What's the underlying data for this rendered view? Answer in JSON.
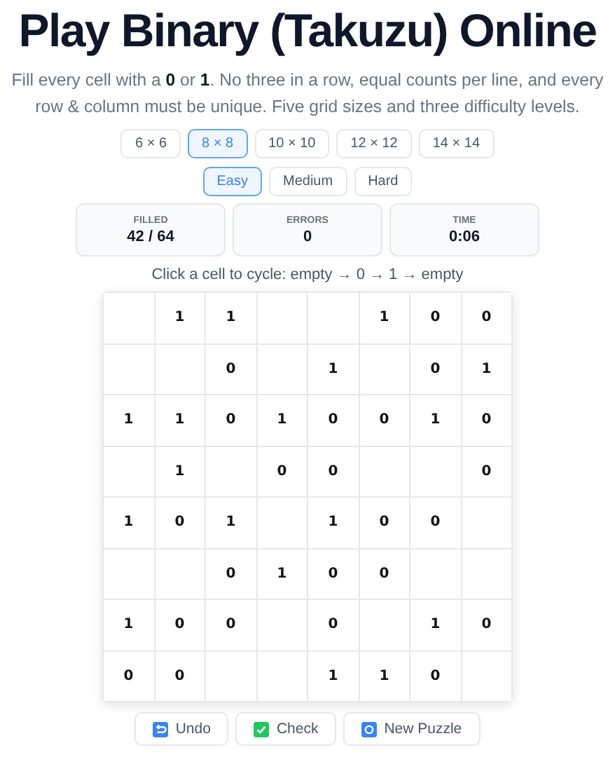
{
  "title": "Play Binary (Takuzu) Online",
  "description": "Fill every cell with a **0** or **1**. No three in a row, equal counts per line, and every row & column must be unique. Five grid sizes and three difficulty levels.",
  "sizes": [
    {
      "label": "6 × 6",
      "selected": false
    },
    {
      "label": "8 × 8",
      "selected": true
    },
    {
      "label": "10 × 10",
      "selected": false
    },
    {
      "label": "12 × 12",
      "selected": false
    },
    {
      "label": "14 × 14",
      "selected": false
    }
  ],
  "difficulties": [
    {
      "label": "Easy",
      "selected": true
    },
    {
      "label": "Medium",
      "selected": false
    },
    {
      "label": "Hard",
      "selected": false
    }
  ],
  "stats": [
    {
      "label": "FILLED",
      "value": "42 / 64"
    },
    {
      "label": "ERRORS",
      "value": "0"
    },
    {
      "label": "TIME",
      "value": "0:06"
    }
  ],
  "hint": "Click a cell to cycle: empty → 0 → 1 → empty",
  "grid": [
    [
      {
        "kind": "empty"
      },
      {
        "kind": "digit",
        "value": "1"
      },
      {
        "kind": "digit",
        "value": "1"
      },
      {
        "kind": "empty"
      },
      {
        "kind": "empty"
      },
      {
        "kind": "digit",
        "value": "1"
      },
      {
        "kind": "digit",
        "value": "0"
      },
      {
        "kind": "digit",
        "value": "0"
      }
    ],
    [
      {
        "kind": "empty"
      },
      {
        "kind": "empty"
      },
      {
        "kind": "digit",
        "value": "0"
      },
      {
        "kind": "empty"
      },
      {
        "kind": "digit",
        "value": "1"
      },
      {
        "kind": "empty"
      },
      {
        "kind": "digit",
        "value": "0"
      },
      {
        "kind": "digit",
        "value": "1"
      }
    ],
    [
      {
        "kind": "digit",
        "value": "1"
      },
      {
        "kind": "digit",
        "value": "1"
      },
      {
        "kind": "digit",
        "value": "0"
      },
      {
        "kind": "digit",
        "value": "1"
      },
      {
        "kind": "digit",
        "value": "0"
      },
      {
        "kind": "digit",
        "value": "0"
      },
      {
        "kind": "digit",
        "value": "1"
      },
      {
        "kind": "digit",
        "value": "0"
      }
    ],
    [
      {
        "kind": "empty"
      },
      {
        "kind": "digit",
        "value": "1"
      },
      {
        "kind": "empty"
      },
      {
        "kind": "digit",
        "value": "0"
      },
      {
        "kind": "digit",
        "value": "0"
      },
      {
        "kind": "empty"
      },
      {
        "kind": "empty"
      },
      {
        "kind": "digit",
        "value": "0"
      }
    ],
    [
      {
        "kind": "digit",
        "value": "1"
      },
      {
        "kind": "digit",
        "value": "0"
      },
      {
        "kind": "digit",
        "value": "1"
      },
      {
        "kind": "empty"
      },
      {
        "kind": "digit",
        "value": "1"
      },
      {
        "kind": "digit",
        "value": "0"
      },
      {
        "kind": "digit",
        "value": "0"
      },
      {
        "kind": "empty"
      }
    ],
    [
      {
        "kind": "empty"
      },
      {
        "kind": "empty"
      },
      {
        "kind": "digit",
        "value": "0"
      },
      {
        "kind": "digit",
        "value": "1"
      },
      {
        "kind": "digit",
        "value": "0"
      },
      {
        "kind": "digit",
        "value": "0"
      },
      {
        "kind": "empty"
      },
      {
        "kind": "empty"
      }
    ],
    [
      {
        "kind": "digit",
        "value": "1"
      },
      {
        "kind": "digit",
        "value": "0"
      },
      {
        "kind": "digit",
        "value": "0"
      },
      {
        "kind": "empty"
      },
      {
        "kind": "digit",
        "value": "0"
      },
      {
        "kind": "empty"
      },
      {
        "kind": "digit",
        "value": "1"
      },
      {
        "kind": "digit",
        "value": "0"
      }
    ],
    [
      {
        "kind": "digit",
        "value": "0"
      },
      {
        "kind": "digit",
        "value": "0"
      },
      {
        "kind": "empty"
      },
      {
        "kind": "empty"
      },
      {
        "kind": "digit",
        "value": "1"
      },
      {
        "kind": "digit",
        "value": "1"
      },
      {
        "kind": "digit",
        "value": "0"
      },
      {
        "kind": "empty"
      }
    ]
  ],
  "actions": [
    {
      "kind": "undo",
      "label": "Undo"
    },
    {
      "kind": "check",
      "label": "Check"
    },
    {
      "kind": "new",
      "label": "New Puzzle"
    }
  ]
}
